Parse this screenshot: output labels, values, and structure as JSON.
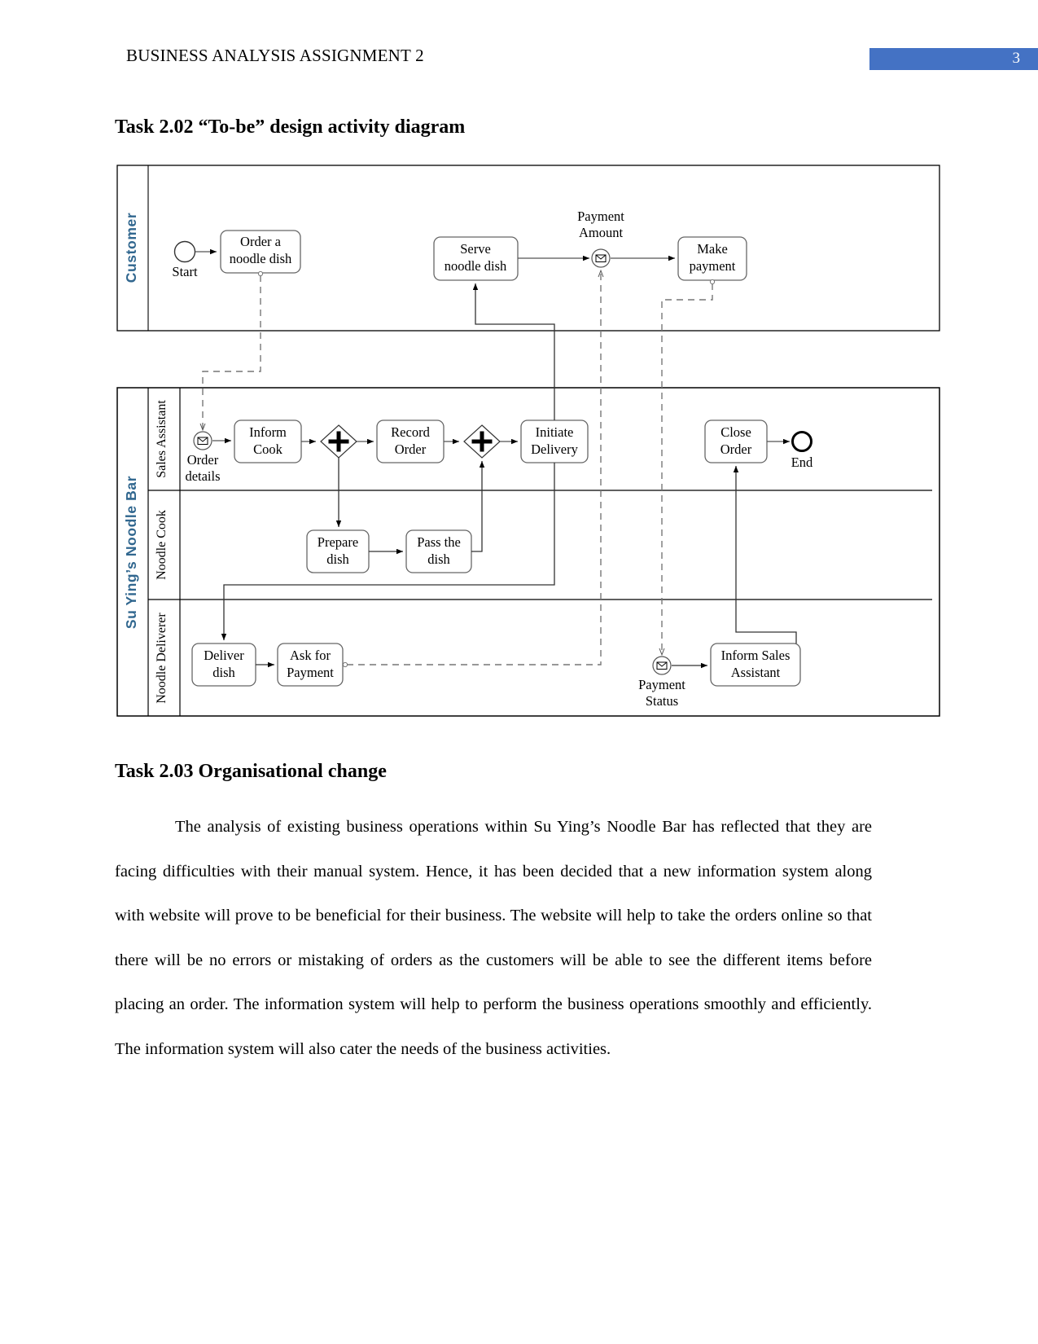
{
  "header": {
    "title": "BUSINESS ANALYSIS ASSIGNMENT 2",
    "page_number": "3",
    "badge_color": "#4472c4"
  },
  "headings": {
    "task_202": "Task 2.02 “To-be” design activity diagram",
    "task_203": "Task 2.03 Organisational change"
  },
  "diagram": {
    "pools": [
      {
        "name": "Customer",
        "label": "Customer",
        "label_color": "#31678f"
      },
      {
        "name": "Su Ying’s Noodle Bar",
        "label": "Su Ying’s Noodle Bar",
        "label_color": "#31678f"
      }
    ],
    "lanes": [
      {
        "label": "Sales Assistant"
      },
      {
        "label": "Noodle Cook"
      },
      {
        "label": "Noodle Deliverer"
      }
    ],
    "events": [
      {
        "id": "start",
        "type": "start-event",
        "label": "Start"
      },
      {
        "id": "payment-amount",
        "type": "message-event",
        "label": "Payment Amount"
      },
      {
        "id": "order-details",
        "type": "message-event",
        "label": "Order details"
      },
      {
        "id": "payment-status",
        "type": "message-event",
        "label": "Payment Status"
      },
      {
        "id": "end",
        "type": "end-event",
        "label": "End"
      }
    ],
    "tasks": [
      {
        "id": "order-noodle-dish",
        "label": "Order a noodle dish",
        "line1": "Order a",
        "line2": "noodle dish"
      },
      {
        "id": "serve-noodle-dish",
        "label": "Serve noodle dish",
        "line1": "Serve",
        "line2": "noodle dish"
      },
      {
        "id": "make-payment",
        "label": "Make payment",
        "line1": "Make",
        "line2": "payment"
      },
      {
        "id": "inform-cook",
        "label": "Inform Cook",
        "line1": "Inform",
        "line2": "Cook"
      },
      {
        "id": "record-order",
        "label": "Record Order",
        "line1": "Record",
        "line2": "Order"
      },
      {
        "id": "initiate-delivery",
        "label": "Initiate Delivery",
        "line1": "Initiate",
        "line2": "Delivery"
      },
      {
        "id": "close-order",
        "label": "Close Order",
        "line1": "Close",
        "line2": "Order"
      },
      {
        "id": "prepare-dish",
        "label": "Prepare dish",
        "line1": "Prepare",
        "line2": "dish"
      },
      {
        "id": "pass-the-dish",
        "label": "Pass the dish",
        "line1": "Pass the",
        "line2": "dish"
      },
      {
        "id": "deliver-dish",
        "label": "Deliver dish",
        "line1": "Deliver",
        "line2": "dish"
      },
      {
        "id": "ask-for-payment",
        "label": "Ask for Payment",
        "line1": "Ask for",
        "line2": "Payment"
      },
      {
        "id": "inform-sales-assistant",
        "label": "Inform Sales Assistant",
        "line1": "Inform Sales",
        "line2": "Assistant"
      }
    ],
    "gateways": [
      {
        "id": "parallel-split",
        "type": "parallel-gateway",
        "symbol": "+"
      },
      {
        "id": "parallel-join",
        "type": "parallel-gateway",
        "symbol": "+"
      }
    ]
  },
  "body": {
    "paragraph": "The analysis of existing business operations within Su Ying’s Noodle Bar has reflected that they are facing difficulties with their manual system. Hence, it has been decided that a new information system along with website will prove to be beneficial for their business. The website will help to take the orders online so that there will be no errors or mistaking of orders as the customers will be able to see the different items before placing an order. The information system will help to perform the business operations smoothly and efficiently. The information system will also cater the needs of the business activities."
  }
}
